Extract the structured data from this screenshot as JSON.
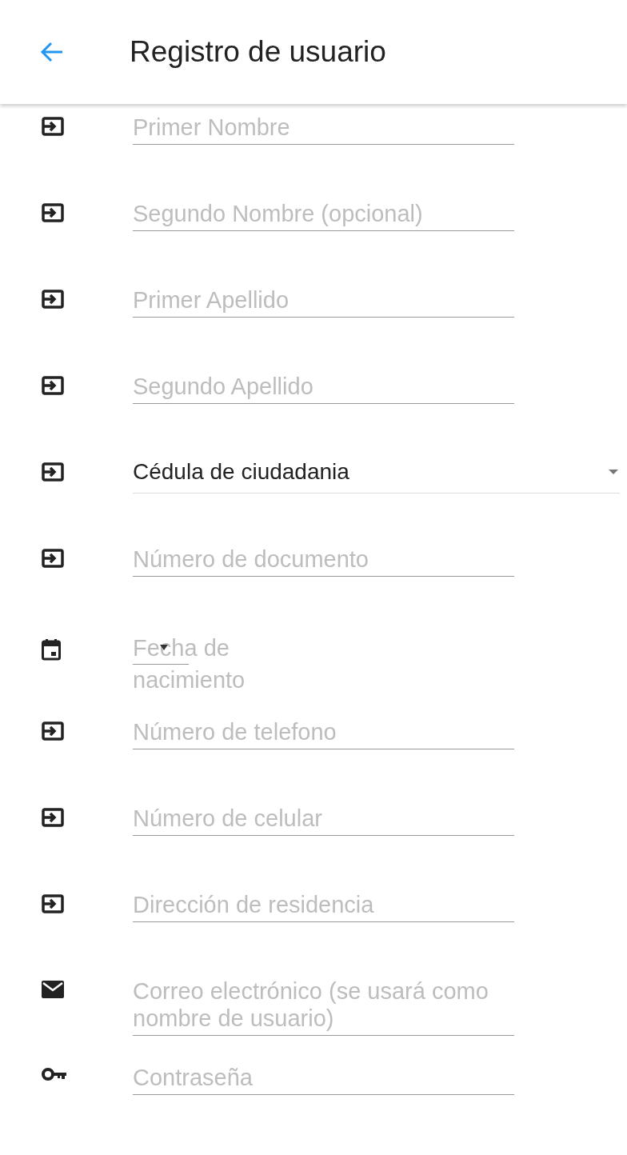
{
  "app_bar": {
    "title": "Registro de usuario"
  },
  "fields": [
    {
      "kind": "text",
      "placeholder": "Primer Nombre"
    },
    {
      "kind": "text",
      "placeholder": "Segundo Nombre (opcional)"
    },
    {
      "kind": "text",
      "placeholder": "Primer Apellido"
    },
    {
      "kind": "text",
      "placeholder": "Segundo Apellido"
    },
    {
      "kind": "select",
      "value": "Cédula de ciudadania"
    },
    {
      "kind": "text",
      "placeholder": "Número de documento"
    },
    {
      "kind": "date",
      "placeholder": "Fecha de nacimiento"
    },
    {
      "kind": "text",
      "placeholder": "Número de telefono"
    },
    {
      "kind": "text",
      "placeholder": "Número de celular"
    },
    {
      "kind": "text",
      "placeholder": "Dirección de residencia"
    },
    {
      "kind": "email",
      "placeholder": "Correo electrónico (se usará como nombre de usuario)"
    },
    {
      "kind": "password",
      "placeholder": "Contraseña"
    }
  ]
}
